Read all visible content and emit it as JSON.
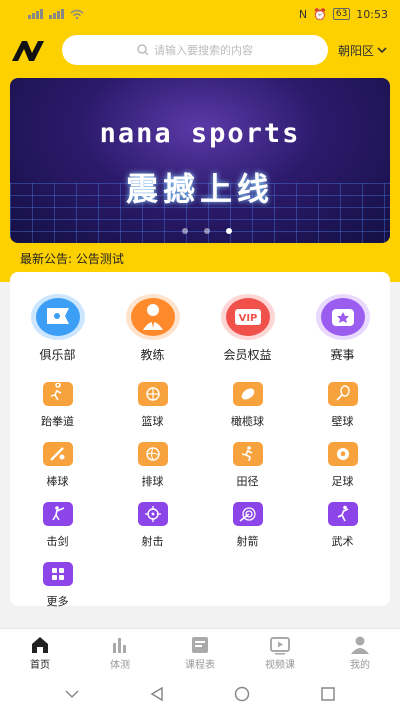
{
  "status": {
    "carrier_icons": "signal-wifi",
    "battery": "63",
    "time": "10:53"
  },
  "header": {
    "search_placeholder": "请输入要搜索的内容",
    "district": "朝阳区"
  },
  "banner": {
    "title": "nana sports",
    "subtitle": "震撼上线",
    "dot_count": 3,
    "active_dot": 2
  },
  "notice": {
    "text": "最新公告: 公告测试"
  },
  "big_items": [
    {
      "label": "俱乐部",
      "icon": "flag-icon"
    },
    {
      "label": "教练",
      "icon": "coach-icon"
    },
    {
      "label": "会员权益",
      "icon": "vip-icon"
    },
    {
      "label": "赛事",
      "icon": "trophy-icon"
    }
  ],
  "small_items": [
    {
      "label": "跆拳道",
      "color": "orange",
      "icon": "taekwondo-icon"
    },
    {
      "label": "篮球",
      "color": "orange",
      "icon": "basketball-icon"
    },
    {
      "label": "橄榄球",
      "color": "orange",
      "icon": "rugby-icon"
    },
    {
      "label": "壁球",
      "color": "orange",
      "icon": "squash-icon"
    },
    {
      "label": "棒球",
      "color": "orange",
      "icon": "baseball-icon"
    },
    {
      "label": "排球",
      "color": "orange",
      "icon": "volleyball-icon"
    },
    {
      "label": "田径",
      "color": "orange",
      "icon": "track-icon"
    },
    {
      "label": "足球",
      "color": "orange",
      "icon": "soccer-icon"
    },
    {
      "label": "击剑",
      "color": "purple",
      "icon": "fencing-icon"
    },
    {
      "label": "射击",
      "color": "purple",
      "icon": "shooting-icon"
    },
    {
      "label": "射箭",
      "color": "purple",
      "icon": "archery-icon"
    },
    {
      "label": "武术",
      "color": "purple",
      "icon": "martial-arts-icon"
    },
    {
      "label": "更多",
      "color": "purple",
      "icon": "more-icon"
    }
  ],
  "tabs": [
    {
      "label": "首页",
      "icon": "home-icon",
      "active": true
    },
    {
      "label": "体测",
      "icon": "chart-icon",
      "active": false
    },
    {
      "label": "课程表",
      "icon": "schedule-icon",
      "active": false
    },
    {
      "label": "视频课",
      "icon": "video-icon",
      "active": false
    },
    {
      "label": "我的",
      "icon": "profile-icon",
      "active": false
    }
  ],
  "colors": {
    "brand_yellow": "#fdd100",
    "orange": "#f7a23c",
    "purple": "#8c45e8"
  }
}
